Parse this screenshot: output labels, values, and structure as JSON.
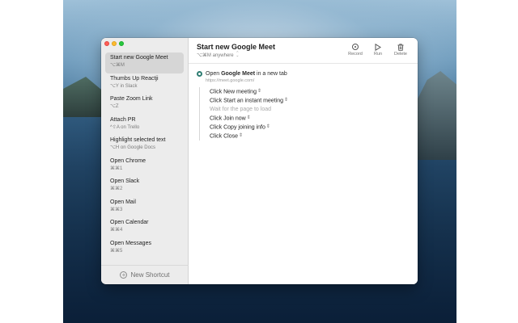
{
  "window": {
    "controls": [
      "close",
      "minimize",
      "zoom"
    ]
  },
  "sidebar": {
    "items": [
      {
        "name": "Start new Google Meet",
        "keys": "⌥⌘M",
        "selected": true
      },
      {
        "name": "Thumbs Up Reactji",
        "keys": "⌥Y in Slack"
      },
      {
        "name": "Paste Zoom Link",
        "keys": "⌥Z"
      },
      {
        "name": "Attach PR",
        "keys": "^⇧A on Trello"
      },
      {
        "name": "Highlight selected text",
        "keys": "⌥H on Google Docs"
      },
      {
        "name": "Open Chrome",
        "keys": "⌘⌘1"
      },
      {
        "name": "Open Slack",
        "keys": "⌘⌘2"
      },
      {
        "name": "Open Mail",
        "keys": "⌘⌘3"
      },
      {
        "name": "Open Calendar",
        "keys": "⌘⌘4"
      },
      {
        "name": "Open Messages",
        "keys": "⌘⌘5"
      }
    ],
    "new_shortcut_label": "New Shortcut"
  },
  "header": {
    "title": "Start new Google Meet",
    "subtitle_keys": "⌥⌘M",
    "subtitle_scope": "anywhere"
  },
  "toolbar": {
    "record_label": "Record",
    "run_label": "Run",
    "delete_label": "Delete"
  },
  "action": {
    "open_prefix": "Open ",
    "open_target": "Google Meet",
    "open_suffix": " in a new tab",
    "url": "https://meet.google.com/"
  },
  "steps": [
    {
      "text": "Click New meeting",
      "type": "click"
    },
    {
      "text": "Click Start an instant meeting",
      "type": "click"
    },
    {
      "text": "Wait for the page to load",
      "type": "wait"
    },
    {
      "text": "Click Join now",
      "type": "click"
    },
    {
      "text": "Click Copy joining info",
      "type": "click"
    },
    {
      "text": "Click Close",
      "type": "click"
    }
  ],
  "colors": {
    "accent_chrome": "#2e7d72",
    "selected_row": "#d6d6d6"
  }
}
